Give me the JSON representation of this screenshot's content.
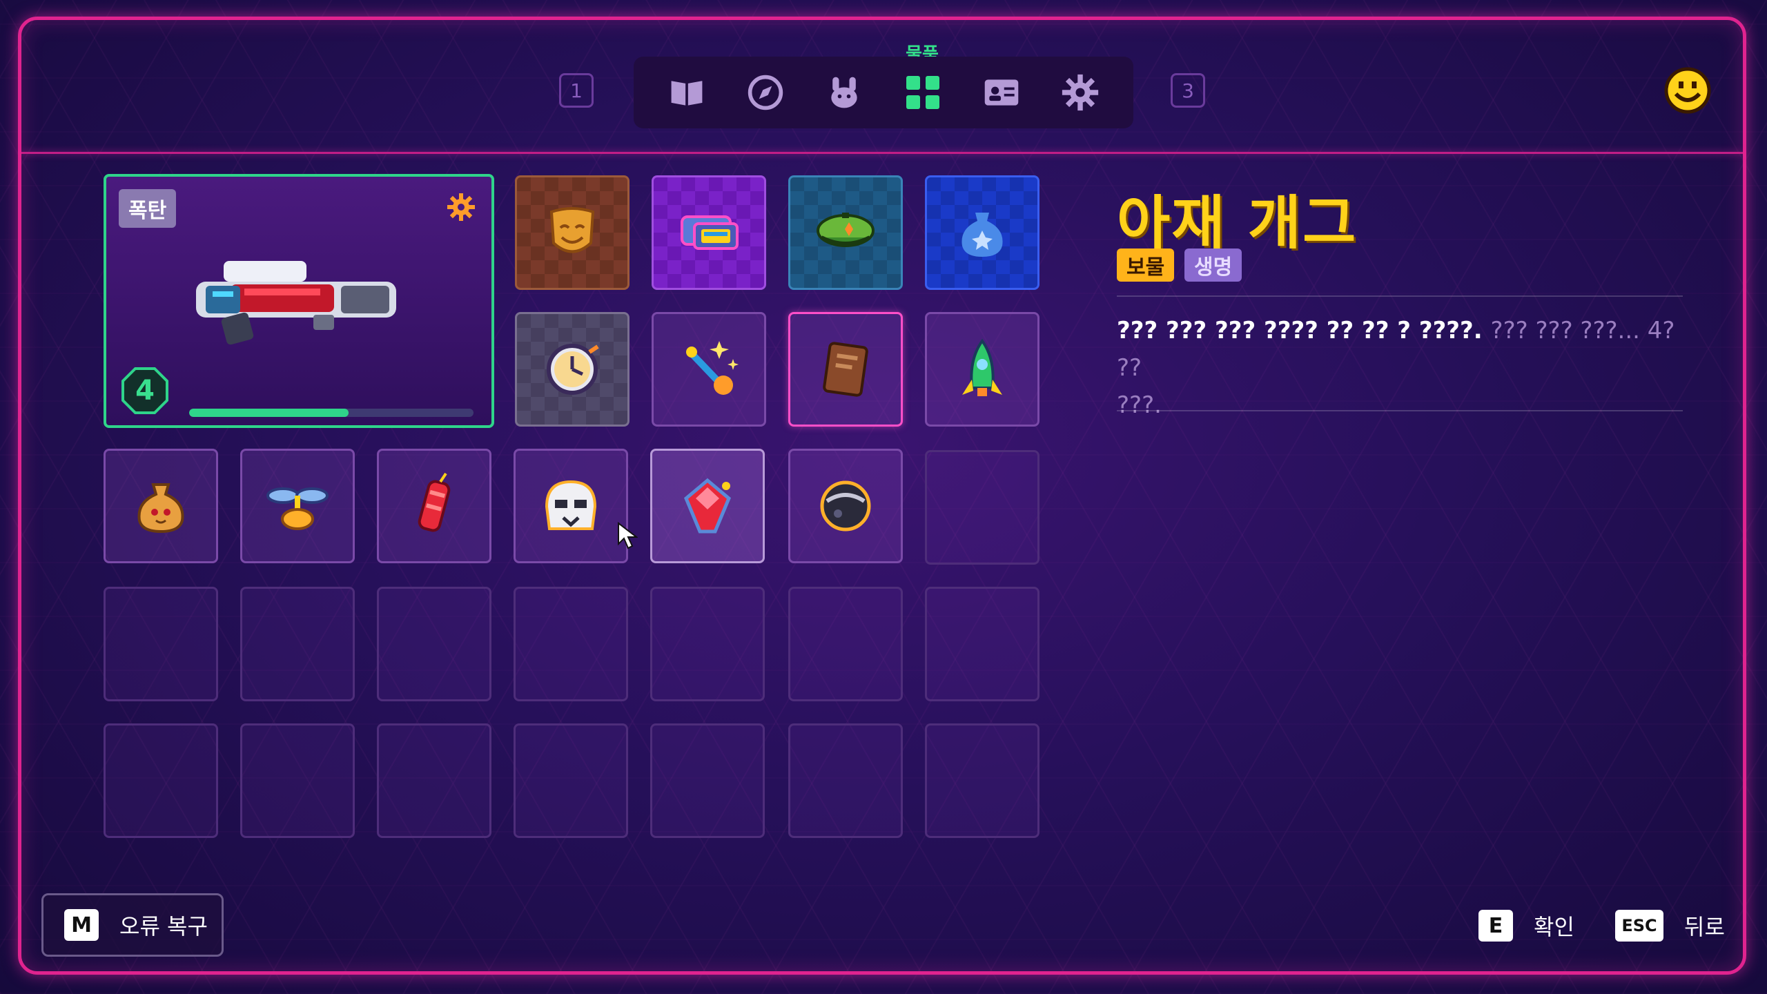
{
  "nav": {
    "left_number": "1",
    "right_number": "3",
    "active_label": "물품",
    "tabs": [
      "book-icon",
      "compass-icon",
      "bunny-icon",
      "grid-icon",
      "id-card-icon",
      "gear-icon"
    ],
    "accent": "#33e08a"
  },
  "weapon": {
    "tag": "폭탄",
    "level": "4",
    "progress": 0.56
  },
  "detail": {
    "title": "아재 개그",
    "tag_treasure": "보물",
    "tag_life": "생명",
    "desc_bright": "??? ??? ??? ???? ?? ?? ? ????.",
    "desc_dim_1": "??? ??? ???... 4? ??",
    "desc_dim_2": "???."
  },
  "footer": {
    "restore_key": "M",
    "restore_label": "오류 복구",
    "confirm_key": "E",
    "confirm_label": "확인",
    "back_key": "ESC",
    "back_label": "뒤로"
  },
  "items": [
    "mask-icon",
    "cassette-icon",
    "beret-icon",
    "blue-pouch-icon",
    "clock-icon",
    "magic-wand-icon",
    "book-icon",
    "rocket-icon",
    "money-bag-icon",
    "propeller-icon",
    "firecracker-icon",
    "trooper-helmet-icon",
    "red-gem-icon",
    "dark-orb-icon"
  ]
}
